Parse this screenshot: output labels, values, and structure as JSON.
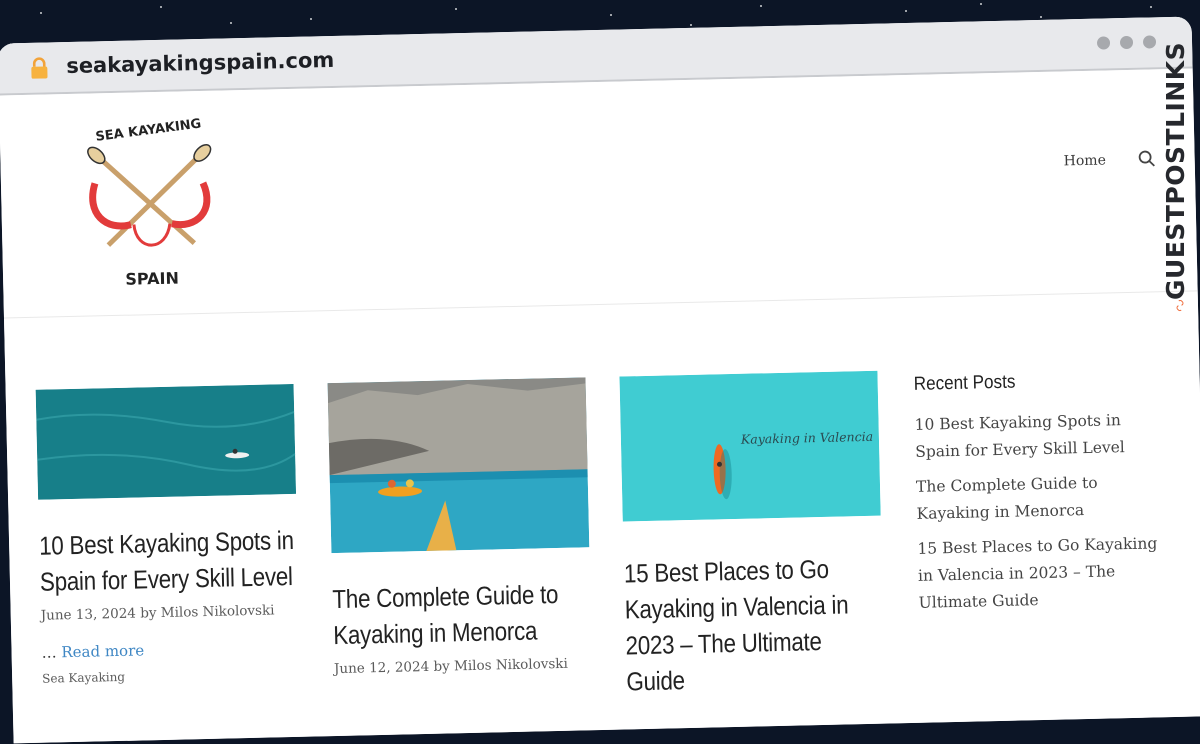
{
  "browser": {
    "url": "seakayakingspain.com"
  },
  "site": {
    "logo_top_text": "SEA KAYAKING",
    "logo_bottom_text": "SPAIN",
    "nav_home": "Home"
  },
  "posts": [
    {
      "title": "10 Best Kayaking Spots in Spain for Every Skill Level",
      "date": "June 13, 2024",
      "by": "by",
      "author": "Milos Nikolovski",
      "ellipsis": "…",
      "read_more": "Read more",
      "category": "Sea Kayaking"
    },
    {
      "title": "The Complete Guide to Kayaking in Menorca",
      "date": "June 12, 2024",
      "by": "by",
      "author": "Milos Nikolovski"
    },
    {
      "title": "15 Best Places to Go Kayaking in Valencia in 2023 – The Ultimate Guide",
      "image_caption": "Kayaking in Valencia"
    }
  ],
  "sidebar": {
    "heading": "Recent Posts",
    "items": [
      "10 Best Kayaking Spots in Spain for Every Skill Level",
      "The Complete Guide to Kayaking in Menorca",
      "15 Best Places to Go Kayaking in Valencia in 2023 – The Ultimate Guide"
    ]
  },
  "watermark": {
    "text": "GUESTPOSTLINKS"
  },
  "colors": {
    "background": "#0c1526",
    "link": "#3f87c4",
    "badge_accent": "#ef6c3b",
    "logo_red": "#e23b3b",
    "logo_tan": "#c9a06b"
  }
}
